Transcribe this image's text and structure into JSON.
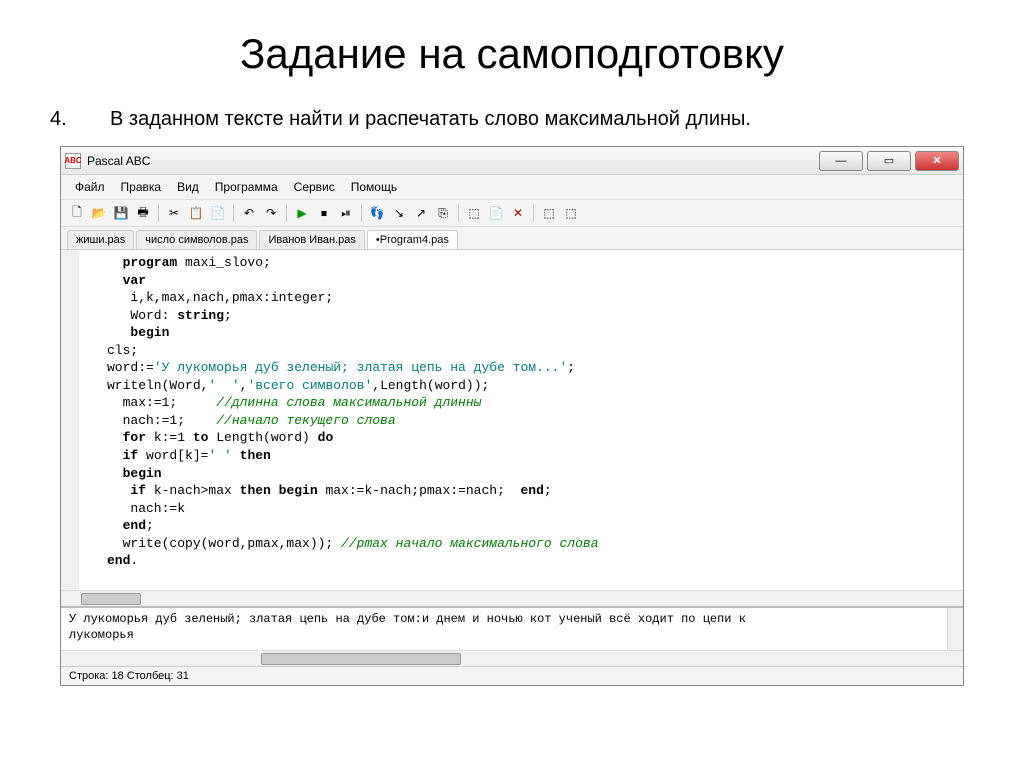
{
  "slide": {
    "title": "Задание на самоподготовку",
    "task_num": "4.",
    "task_text": "В заданном тексте найти и распечатать слово максимальной длины."
  },
  "app": {
    "icon_text": "ABC",
    "title": "Pascal ABC",
    "menu": [
      "Файл",
      "Правка",
      "Вид",
      "Программа",
      "Сервис",
      "Помощь"
    ],
    "tabs": [
      "жиши.pas",
      "число символов.pas",
      "Иванов Иван.pas",
      "•Program4.pas"
    ],
    "active_tab": 3,
    "status": "Строка: 18    Столбец: 31",
    "output": "У лукоморья дуб зеленый; златая цепь на дубе том:и днем и ночью кот ученый всё ходит по цепи к\nлукоморья"
  },
  "code": {
    "l1a": "  program",
    "l1b": " maxi_slovo;",
    "l2": "  var",
    "l3": "   i,k,max,nach,pmax:integer;",
    "l4a": "   Word: ",
    "l4b": "string",
    "l4c": ";",
    "l5": "   begin",
    "l6": "cls;",
    "l7a": "word:=",
    "l7b": "'У лукоморья дуб зеленый; златая цепь на дубе том...'",
    "l7c": ";",
    "l8a": "writeln(Word,",
    "l8b": "'  '",
    "l8c": ",",
    "l8d": "'всего символов'",
    "l8e": ",Length(word));",
    "l9a": "  max:=1;     ",
    "l9b": "//длинна слова максимальной длинны",
    "l10a": "  nach:=1;    ",
    "l10b": "//начало текущего слова",
    "l11a": "  for",
    "l11b": " k:=1 ",
    "l11c": "to",
    "l11d": " Length(word) ",
    "l11e": "do",
    "l12a": "  if",
    "l12b": " word[k]=",
    "l12c": "' '",
    "l12d": " ",
    "l12e": "then",
    "l13": "  begin",
    "l14a": "   if",
    "l14b": " k-nach>max ",
    "l14c": "then begin",
    "l14d": " max:=k-nach;pmax:=nach;  ",
    "l14e": "end",
    "l14f": ";",
    "l15": "   nach:=k",
    "l16a": "  end",
    "l16b": ";",
    "l17a": "  write(copy(word,pmax,max)); ",
    "l17b": "//pmax начало максимального слова",
    "l18a": "end",
    "l18b": "."
  },
  "toolbar_icons": [
    "🗋",
    "📂",
    "💾",
    "🖶",
    "✂",
    "📋",
    "📄",
    "↶",
    "↷",
    "▶",
    "⏹",
    "⏯",
    "👣",
    "↘",
    "↗",
    "⎘",
    "⬚",
    "📄",
    "✕",
    "⬚",
    "⬚"
  ]
}
